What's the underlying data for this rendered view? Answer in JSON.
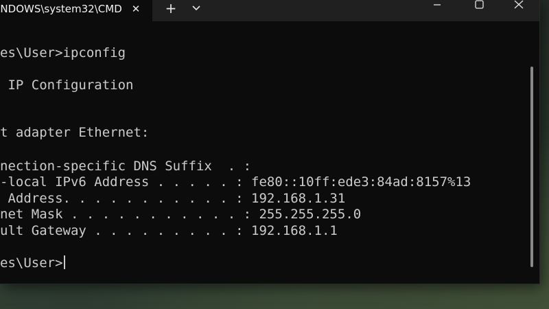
{
  "window": {
    "tab_title": "INDOWS\\system32\\CMD",
    "tab_close_glyph": "✕",
    "new_tab_glyph": "+"
  },
  "console": {
    "lines": [
      "es\\User>ipconfig",
      " IP Configuration",
      "t adapter Ethernet:",
      "nection-specific DNS Suffix  . :",
      "-local IPv6 Address . . . . . : fe80::10ff:ede3:84ad:8157%13",
      " Address. . . . . . . . . . . : 192.168.1.31",
      "net Mask . . . . . . . . . . . : 255.255.255.0",
      "ult Gateway . . . . . . . . . : 192.168.1.1",
      "es\\User>"
    ]
  }
}
